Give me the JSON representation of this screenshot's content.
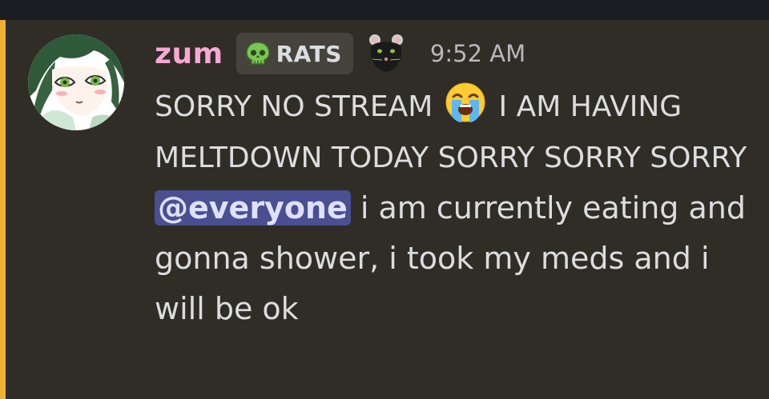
{
  "message": {
    "author": "zum",
    "author_color": "#f9a8d4",
    "role_tag": {
      "icon": "green-skull-icon",
      "label": "RATS"
    },
    "decoration": "rat-icon",
    "timestamp": "9:52 AM",
    "content": {
      "part1": "SORRY NO STREAM",
      "emoji": "loudly-crying-face-emoji",
      "part2": "I AM HAVING MELTDOWN TODAY SORRY SORRY SORRY",
      "mention": "@everyone",
      "part3": "i am currently eating and gonna shower, i took my meds and i will be ok"
    }
  },
  "colors": {
    "mention_highlight_bar": "#f0b232",
    "mention_background": "#4a4f92",
    "message_background": "#2f2d26"
  }
}
